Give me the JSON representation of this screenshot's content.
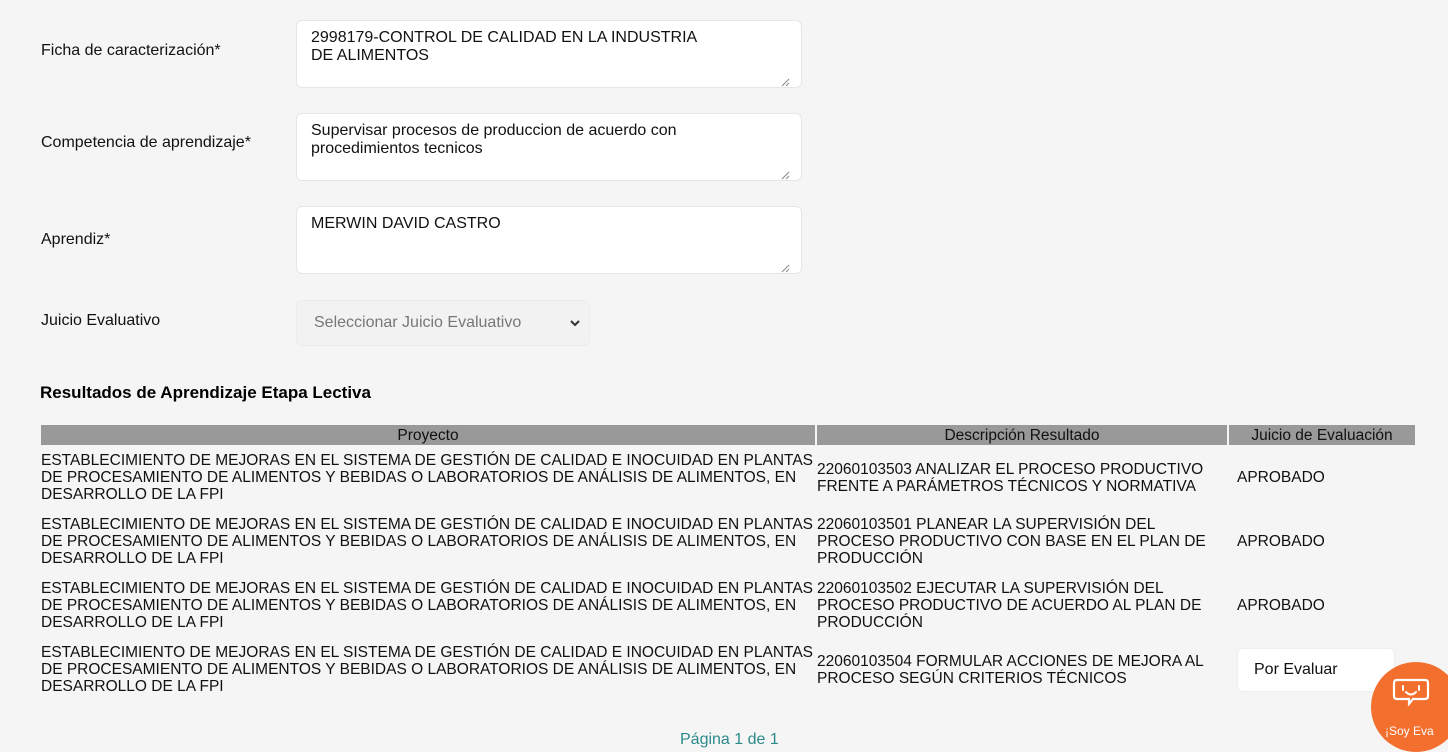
{
  "form": {
    "ficha_label": "Ficha de caracterización*",
    "ficha_value": "2998179-CONTROL DE CALIDAD EN LA INDUSTRIA\nDE ALIMENTOS",
    "competencia_label": "Competencia de aprendizaje*",
    "competencia_value": "Supervisar procesos de produccion de acuerdo con\nprocedimientos tecnicos",
    "aprendiz_label": "Aprendiz*",
    "aprendiz_value": "MERWIN DAVID CASTRO",
    "juicio_label": "Juicio Evaluativo",
    "juicio_placeholder": "Seleccionar Juicio Evaluativo"
  },
  "results": {
    "title": "Resultados de Aprendizaje Etapa Lectiva",
    "headers": [
      "Proyecto",
      "Descripción Resultado",
      "Juicio de Evaluación"
    ],
    "rows": [
      {
        "proyecto": "ESTABLECIMIENTO DE MEJORAS EN EL SISTEMA DE GESTIÓN DE CALIDAD E INOCUIDAD EN PLANTAS DE PROCESAMIENTO DE ALIMENTOS Y BEBIDAS O LABORATORIOS DE ANÁLISIS DE ALIMENTOS, EN DESARROLLO DE LA FPI",
        "descripcion": "22060103503 ANALIZAR EL PROCESO PRODUCTIVO FRENTE A PARÁMETROS TÉCNICOS Y NORMATIVA",
        "juicio": "APROBADO"
      },
      {
        "proyecto": "ESTABLECIMIENTO DE MEJORAS EN EL SISTEMA DE GESTIÓN DE CALIDAD E INOCUIDAD EN PLANTAS DE PROCESAMIENTO DE ALIMENTOS Y BEBIDAS O LABORATORIOS DE ANÁLISIS DE ALIMENTOS, EN DESARROLLO DE LA FPI",
        "descripcion": "22060103501 PLANEAR LA SUPERVISIÓN DEL PROCESO PRODUCTIVO CON BASE EN EL PLAN DE PRODUCCIÓN",
        "juicio": "APROBADO"
      },
      {
        "proyecto": "ESTABLECIMIENTO DE MEJORAS EN EL SISTEMA DE GESTIÓN DE CALIDAD E INOCUIDAD EN PLANTAS DE PROCESAMIENTO DE ALIMENTOS Y BEBIDAS O LABORATORIOS DE ANÁLISIS DE ALIMENTOS, EN DESARROLLO DE LA FPI",
        "descripcion": "22060103502 EJECUTAR LA SUPERVISIÓN DEL PROCESO PRODUCTIVO DE ACUERDO AL PLAN DE PRODUCCIÓN",
        "juicio": "APROBADO"
      },
      {
        "proyecto": "ESTABLECIMIENTO DE MEJORAS EN EL SISTEMA DE GESTIÓN DE CALIDAD E INOCUIDAD EN PLANTAS DE PROCESAMIENTO DE ALIMENTOS Y BEBIDAS O LABORATORIOS DE ANÁLISIS DE ALIMENTOS, EN DESARROLLO DE LA FPI",
        "descripcion": "22060103504 FORMULAR ACCIONES DE MEJORA AL PROCESO SEGÚN CRITERIOS TÉCNICOS",
        "juicio_input": "Por Evaluar"
      }
    ],
    "pagination": "Página 1 de 1"
  },
  "widget": {
    "label": "¡Soy Eva",
    "icon": "chat-robot-icon",
    "color": "#f36f2e"
  }
}
